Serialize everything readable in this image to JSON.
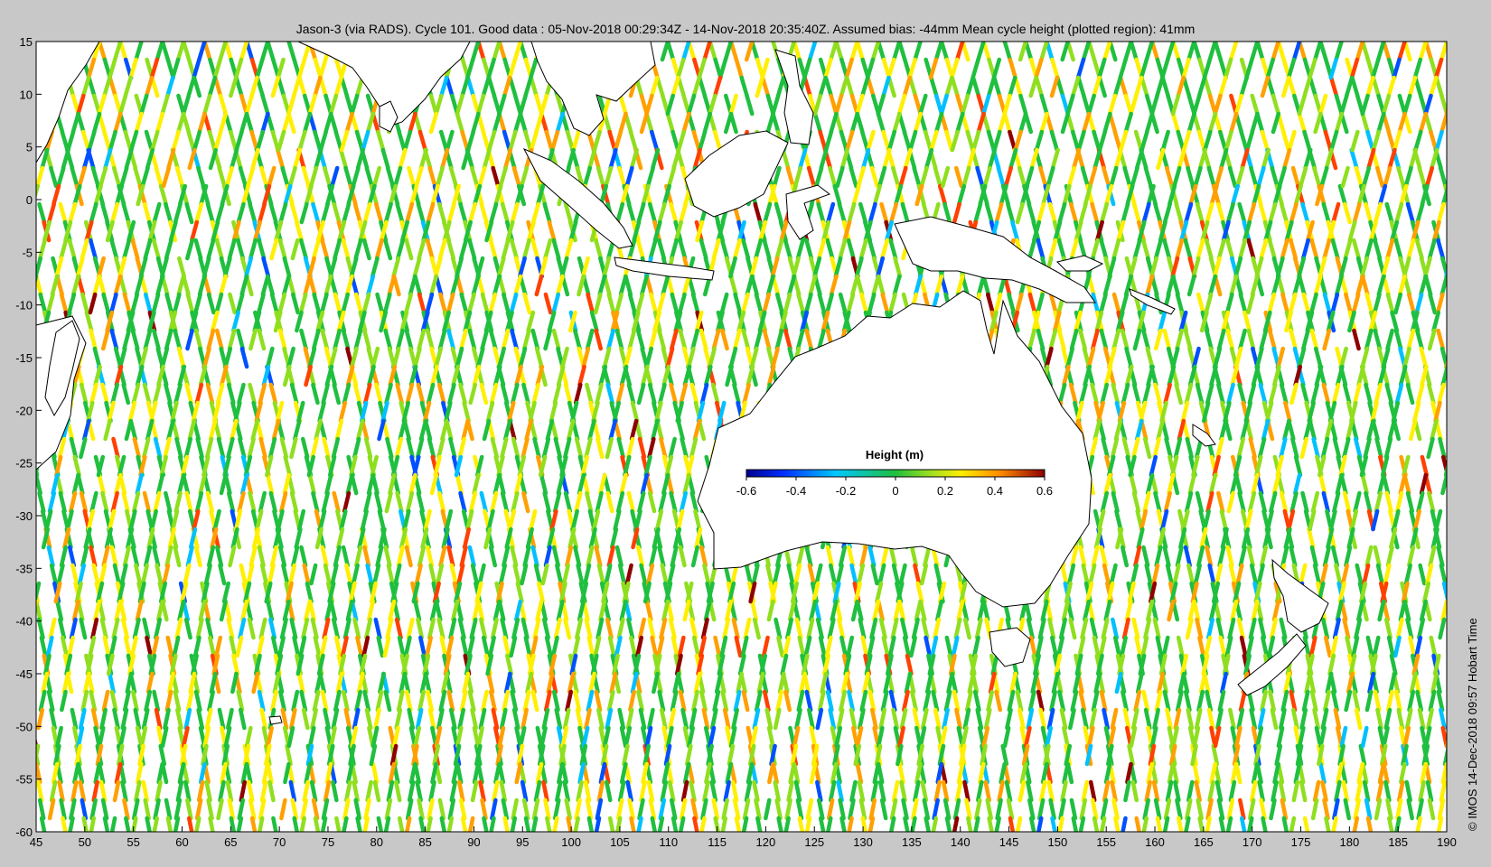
{
  "title": "Jason-3 (via RADS). Cycle 101. Good data : 05-Nov-2018 00:29:34Z - 14-Nov-2018 20:35:40Z. Assumed bias: -44mm  Mean cycle height (plotted region): 41mm",
  "stamp": "© IMOS 14-Dec-2018 09:57 Hobart Time",
  "map": {
    "lon_range": [
      45,
      190
    ],
    "lat_range": [
      -60,
      15
    ],
    "x_ticks": [
      45,
      50,
      55,
      60,
      65,
      70,
      75,
      80,
      85,
      90,
      95,
      100,
      105,
      110,
      115,
      120,
      125,
      130,
      135,
      140,
      145,
      150,
      155,
      160,
      165,
      170,
      175,
      180,
      185,
      190
    ],
    "y_ticks": [
      15,
      10,
      5,
      0,
      -5,
      -10,
      -15,
      -20,
      -25,
      -30,
      -35,
      -40,
      -45,
      -50,
      -55,
      -60
    ],
    "land_color": "#ffffff",
    "track_colors": [
      "#00008f",
      "#0050ff",
      "#00c0ff",
      "#1fbf3f",
      "#8fdf1f",
      "#ffef00",
      "#ffa000",
      "#ff4000",
      "#8f0000"
    ]
  },
  "colorbar": {
    "title": "Height (m)",
    "ticks": [
      "-0.6",
      "-0.4",
      "-0.2",
      "0",
      "0.2",
      "0.4",
      "0.6"
    ],
    "range": [
      -0.6,
      0.6
    ]
  }
}
